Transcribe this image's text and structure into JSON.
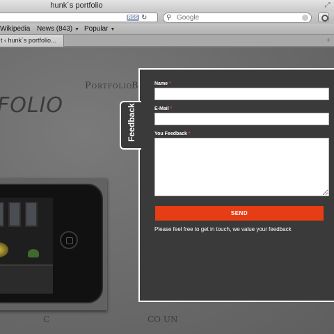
{
  "window": {
    "title": "hunk´s portfolio"
  },
  "toolbar": {
    "rss_label": "RSS",
    "search_placeholder": "Google"
  },
  "bookmarks": [
    {
      "label": "Wikipedia"
    },
    {
      "label": "News (843)"
    },
    {
      "label": "Popular"
    }
  ],
  "tab": {
    "label": "t ‹ hunk´s portfolio..."
  },
  "page": {
    "logo": "FOLIO",
    "nav_portfolio": "Portfolio",
    "nav_next": "B",
    "bottom_left": "C",
    "bottom_right": "CO UN"
  },
  "feedback": {
    "tab_label": "Feedback",
    "name_label": "Name",
    "email_label": "E-Mail",
    "message_label": "You Feedback",
    "required_mark": "*",
    "send_label": "SEND",
    "note": "Please feel free to get in touch, we value your feedback"
  },
  "colors": {
    "accent": "#e63d15",
    "panel": "#3a3a3a"
  }
}
